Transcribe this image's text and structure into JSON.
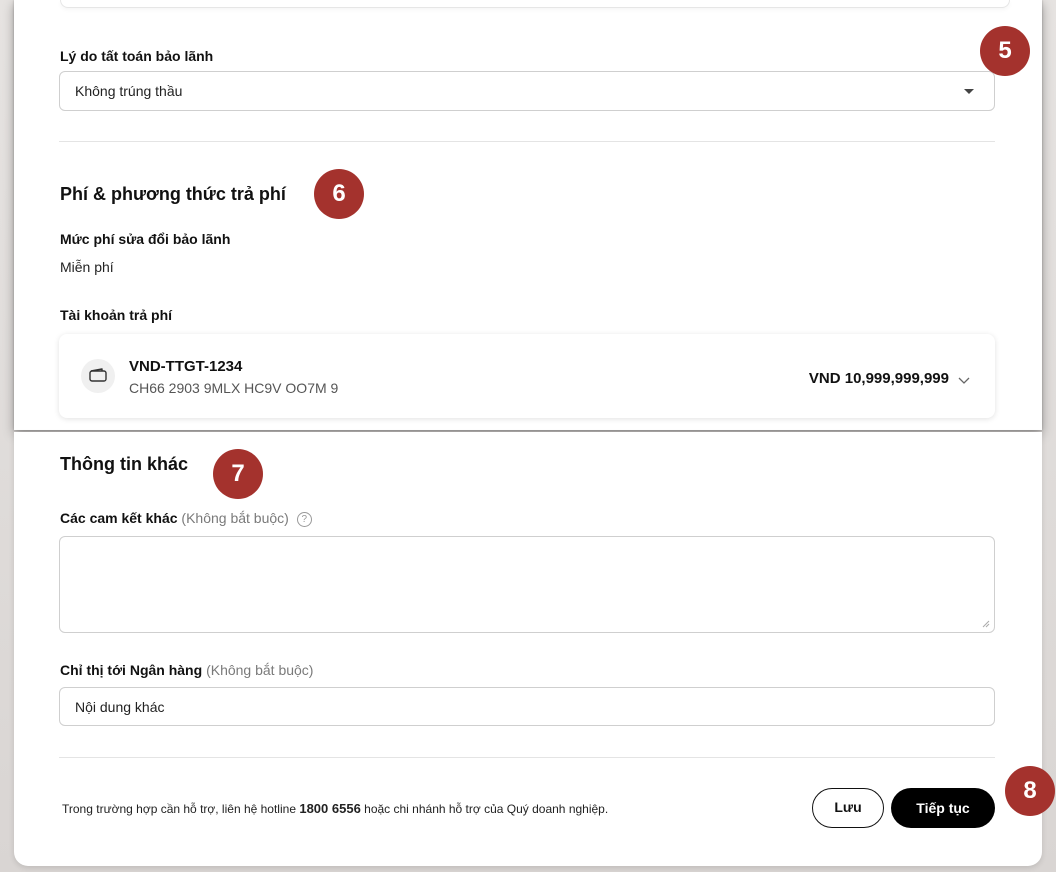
{
  "reason": {
    "label": "Lý do tất toán bảo lãnh",
    "selected": "Không trúng thầu"
  },
  "fee": {
    "heading": "Phí & phương thức trả phí",
    "amount_label": "Mức phí sửa đổi bảo lãnh",
    "amount_value": "Miễn phí",
    "account_label": "Tài khoản trả phí",
    "account": {
      "name": "VND-TTGT-1234",
      "number": "CH66 2903 9MLX HC9V OO7M 9",
      "balance": "VND 10,999,999,999"
    }
  },
  "other": {
    "heading": "Thông tin khác",
    "commitments_label": "Các cam kết khác",
    "commitments_optional": "(Không bắt buộc)",
    "commitments_value": "",
    "instructions_label": "Chỉ thị tới Ngân hàng",
    "instructions_optional": "(Không bắt buộc)",
    "instructions_value": "Nội dung khác"
  },
  "footer": {
    "support_prefix": "Trong trường hợp cần hỗ trợ, liên hệ hotline",
    "hotline": "1800 6556",
    "support_suffix": "hoặc chi nhánh hỗ trợ của Quý doanh nghiệp.",
    "save_label": "Lưu",
    "continue_label": "Tiếp tục"
  },
  "badges": {
    "b5": "5",
    "b6": "6",
    "b7": "7",
    "b8": "8"
  },
  "colors": {
    "badge": "#a4322d",
    "primary_button": "#000000"
  },
  "icons": {
    "wallet": "wallet-icon",
    "caret": "caret-down-icon",
    "chevron": "chevron-down-icon",
    "help": "help-circle-icon"
  }
}
